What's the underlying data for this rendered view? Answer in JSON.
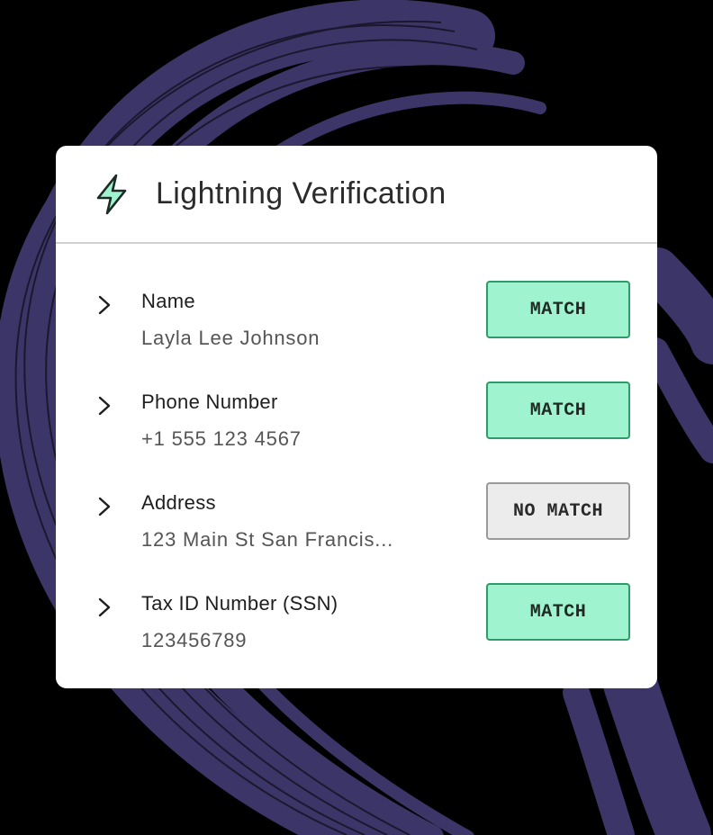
{
  "card": {
    "title": "Lightning Verification",
    "icon": "lightning-bolt-icon",
    "accent_color": "#9ff3cf"
  },
  "fields": [
    {
      "label": "Name",
      "value": "Layla Lee Johnson",
      "status": "MATCH"
    },
    {
      "label": "Phone Number",
      "value": "+1 555 123 4567",
      "status": "MATCH"
    },
    {
      "label": "Address",
      "value": "123 Main St San Francis...",
      "status": "NO MATCH"
    },
    {
      "label": "Tax ID Number (SSN)",
      "value": "123456789",
      "status": "MATCH"
    }
  ],
  "colors": {
    "background": "#000000",
    "brush": "#3c3568",
    "match_fill": "#9ff3cf",
    "match_border": "#2f9a6a",
    "nomatch_fill": "#ececec"
  }
}
